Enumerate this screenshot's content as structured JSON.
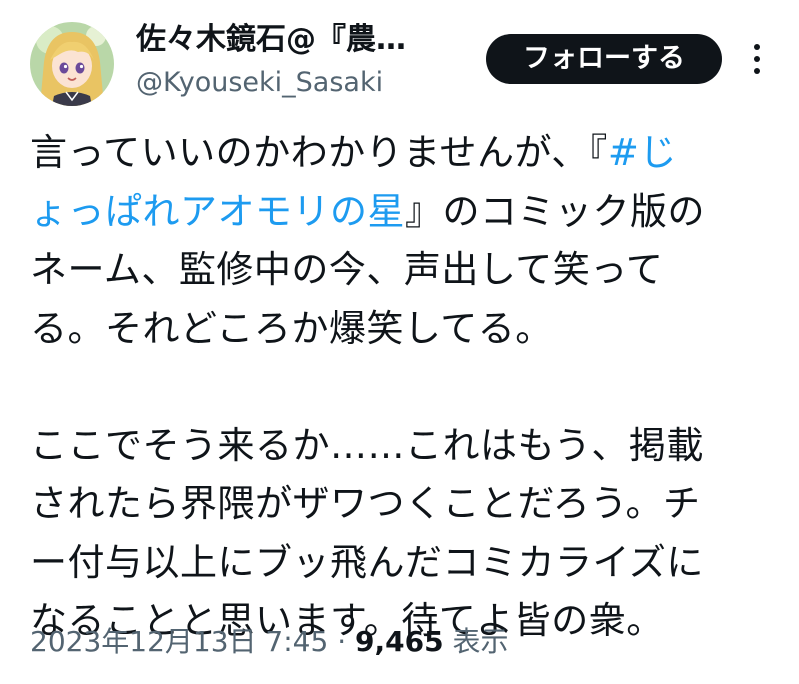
{
  "tweet": {
    "author": {
      "display_name": "佐々木鏡石@『農…",
      "handle": "@Kyouseki_Sasaki",
      "avatar_icon": "avatar-anime-girl-icon"
    },
    "follow_label": "フォローする",
    "more_icon": "more-dots-icon",
    "text": {
      "p1_l1_a": "言っていいのかわかりませんが、『",
      "p1_l1_tag": "#じ",
      "p1_l2_tag": "ょっぱれアオモリの星",
      "p1_l2_b": "』のコミック版の",
      "p1_l3": "ネーム、監修中の今、声出して笑って",
      "p1_l4": "る。それどころか爆笑してる。",
      "p2_l1": "ここでそう来るか……これはもう、掲載",
      "p2_l2": "されたら界隈がザワつくことだろう。チ",
      "p2_l3": "ー付与以上にブッ飛んだコミカライズに",
      "p2_l4": "なることと思います。待てよ皆の衆。"
    },
    "timestamp": "2023年12月13日 7:45",
    "separator": " · ",
    "views_count": "9,465",
    "views_label": " 表示"
  },
  "colors": {
    "text": "#0f1419",
    "secondary": "#536471",
    "link": "#1d9bf0",
    "button_bg": "#0f1419"
  }
}
